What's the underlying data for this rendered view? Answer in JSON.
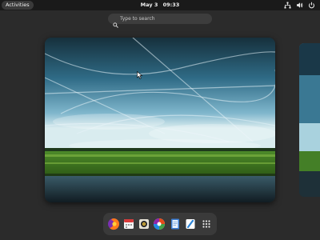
{
  "topbar": {
    "activities_label": "Activities",
    "date": "May 3",
    "time": "09:33",
    "tray_icons": [
      "network-icon",
      "volume-icon",
      "power-icon"
    ]
  },
  "search": {
    "placeholder": "Type to search",
    "value": ""
  },
  "workspaces": {
    "current_wallpaper": "sky-over-grassland-and-water",
    "next_wallpaper": "sky-over-grassland-and-water"
  },
  "dock": {
    "items": [
      {
        "icon": "firefox-icon"
      },
      {
        "icon": "calendar-icon"
      },
      {
        "icon": "rhythmbox-icon"
      },
      {
        "icon": "software-center-icon"
      },
      {
        "icon": "text-editor-icon"
      },
      {
        "icon": "help-icon"
      },
      {
        "icon": "app-grid-icon"
      }
    ]
  },
  "colors": {
    "background": "#2b2b2b",
    "topbar": "#1a1a1a",
    "dock": "#3a3a3a",
    "search": "#3d3d3d"
  }
}
